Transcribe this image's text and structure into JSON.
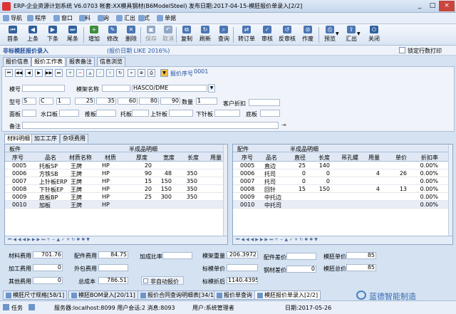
{
  "window": {
    "title": "ERP-企业资源计划系统 V6.0703 帐套:XX模具钢材(B6ModelSteel) 发布日期:2017-04-15-模胚报价单录入[2/2]",
    "min": "_",
    "max": "□",
    "close": "×"
  },
  "menu": [
    "导航",
    "程序",
    "窗口",
    "资料",
    "查询",
    "汇出",
    "样式",
    "单据"
  ],
  "toolbar": [
    "首条",
    "上条",
    "下条",
    "尾条",
    "增加",
    "修改",
    "删除",
    "保存",
    "取消",
    "复制",
    "刷新",
    "查询",
    "转订单",
    "审核",
    "反审核",
    "作废",
    "预览",
    "汇出",
    "关闭"
  ],
  "header": {
    "title": "非标模胚报价录入",
    "filter": "(报价日期 LIKE 2016%)",
    "lock_label": "锁定行数打印"
  },
  "tabs": [
    "报价信息",
    "报价工作表",
    "报表备注",
    "信息浏览"
  ],
  "form": {
    "quote_no_label": "报价序号",
    "quote_no": "0001",
    "mold_label": "模号",
    "mold_value": "",
    "mold_name_label": "模架名称",
    "mold_name": "HASCO/DME",
    "type_label": "型号",
    "type_s": "S",
    "type_c": "C",
    "type_1": "1",
    "dims": [
      "25",
      "35",
      "60",
      "80",
      "90"
    ],
    "qty_label": "数量",
    "qty": "1",
    "discount_label": "客户折扣",
    "discount": "",
    "plate_labels": [
      "面板",
      "水口板",
      "推板",
      "托板",
      "上针板",
      "下针板",
      "底板"
    ],
    "remark_label": "备注",
    "remark": ""
  },
  "subtabs": [
    "材料明细",
    "加工工序",
    "杂项费用"
  ],
  "left_grid": {
    "group1": "板件",
    "group2": "半成品明细",
    "cols": [
      "序号",
      "品名",
      "材质名称",
      "材质",
      "厚度",
      "宽度",
      "长度",
      "用量"
    ],
    "rows": [
      [
        "0005",
        "托板SP",
        "王牌",
        "HP",
        "20",
        "",
        "",
        ""
      ],
      [
        "0006",
        "方铁SB",
        "王牌",
        "HP",
        "90",
        "48",
        "350",
        ""
      ],
      [
        "0007",
        "上针板ERP",
        "王牌",
        "HP",
        "15",
        "150",
        "350",
        ""
      ],
      [
        "0008",
        "下针板EP",
        "王牌",
        "HP",
        "20",
        "150",
        "350",
        ""
      ],
      [
        "0009",
        "底板BP",
        "王牌",
        "HP",
        "25",
        "300",
        "350",
        ""
      ],
      [
        "0010",
        "加板",
        "王牌",
        "HP",
        "",
        "",
        "",
        ""
      ]
    ]
  },
  "right_grid": {
    "group1": "配件",
    "group2": "半成品明细",
    "cols": [
      "序号",
      "品名",
      "直径",
      "长度",
      "吊孔螺",
      "用量",
      "单价",
      "折扣率"
    ],
    "rows": [
      [
        "0005",
        "直边",
        "25",
        "140",
        "",
        "",
        "",
        "0.00%"
      ],
      [
        "0006",
        "托司",
        "0",
        "0",
        "",
        "4",
        "26",
        "0.00%"
      ],
      [
        "0007",
        "托司",
        "0",
        "0",
        "",
        "",
        "",
        "0.00%"
      ],
      [
        "0008",
        "回针",
        "15",
        "150",
        "",
        "4",
        "13",
        "0.00%"
      ],
      [
        "0009",
        "中托边",
        "",
        "",
        "",
        "",
        "",
        "0.00%"
      ],
      [
        "0010",
        "中托司",
        "",
        "",
        "",
        "",
        "",
        "0.00%"
      ]
    ]
  },
  "summary": {
    "mat_cost_label": "材料费用",
    "mat_cost": "701.76",
    "part_cost_label": "配件费用",
    "part_cost": "84.75",
    "proc_label": "加工费用",
    "proc": "0",
    "outsrc_label": "外包费用",
    "outsrc": "",
    "other_label": "其他费用",
    "other": "0",
    "total_label": "总成本",
    "total": "786.51",
    "add_ratio_label": "加成比率",
    "add_ratio": "",
    "auto_label": "非自动报价",
    "weight_label": "模架重量",
    "weight": "206.3972",
    "std_price_label": "标模单价",
    "std_price": "",
    "std_disc_label": "标模折后",
    "std_disc": "1140.4395",
    "part_diff_label": "配件差价",
    "part_diff": "",
    "steel_diff_label": "钢材差价",
    "steel_diff": "0",
    "mold_price_label": "模胚单价",
    "mold_price": "85",
    "mold_total_label": "模胚总价",
    "mold_total": "85"
  },
  "bottom_tabs": [
    "模胚尺寸规格[58/1]",
    "模胚BOM录入[20/11]",
    "报价合同查询明细表[34/1]",
    "报价单查询",
    "模胚报价单录入[2/2]"
  ],
  "status": {
    "task": "任务",
    "server": "服务器:localhost:8099 用户会话:2 消息:8093",
    "user": "用户:系统管理者",
    "date": "日期:2017-05-26"
  },
  "watermark": "蓝德智能制造"
}
